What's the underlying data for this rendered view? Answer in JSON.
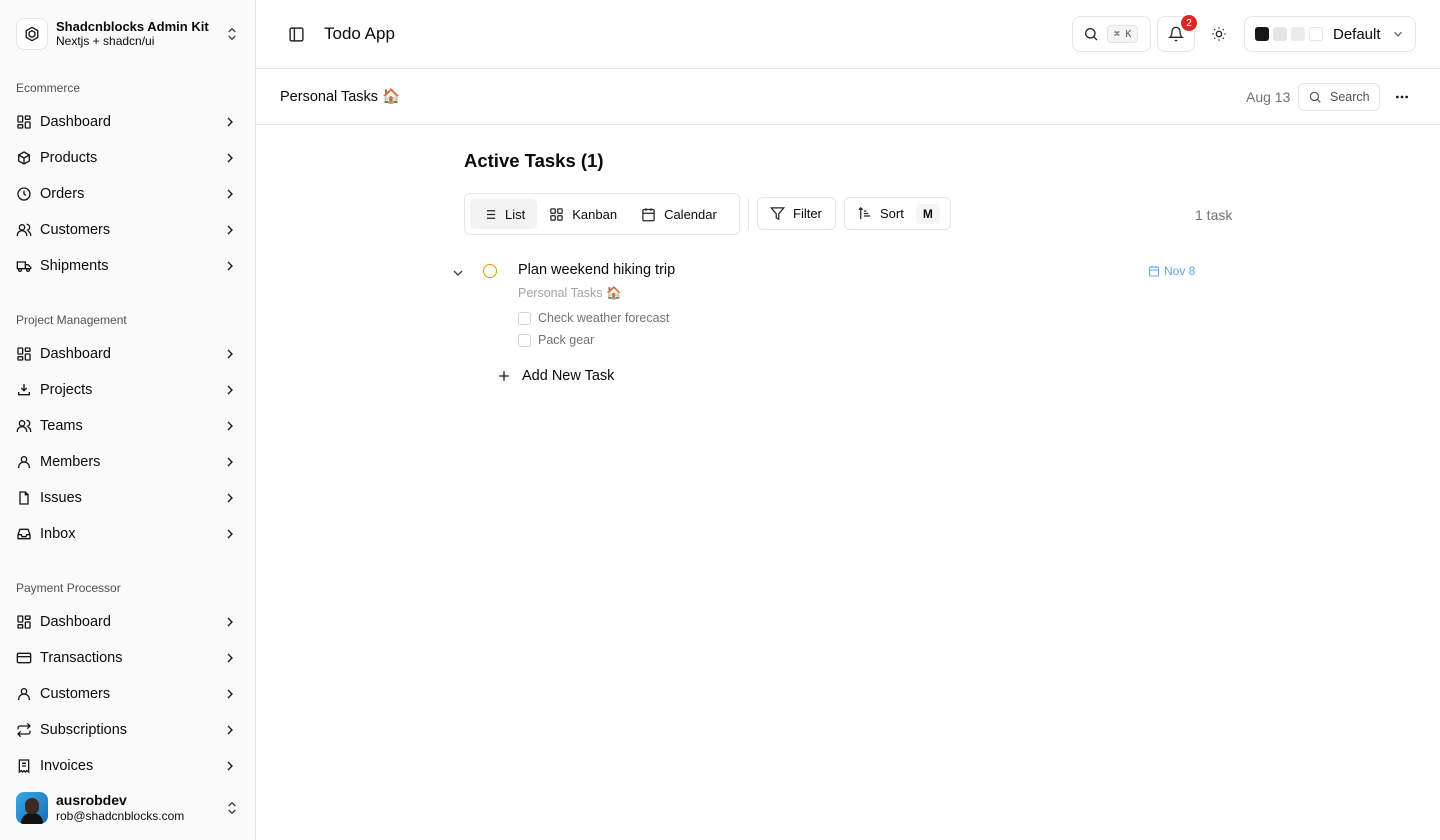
{
  "team": {
    "name": "Shadcnblocks Admin Kit",
    "subtitle": "Nextjs + shadcn/ui"
  },
  "groups": [
    {
      "label": "Ecommerce",
      "items": [
        {
          "label": "Dashboard",
          "icon": "layout-grid-icon"
        },
        {
          "label": "Products",
          "icon": "package-icon"
        },
        {
          "label": "Orders",
          "icon": "clipboard-icon"
        },
        {
          "label": "Customers",
          "icon": "users-icon"
        },
        {
          "label": "Shipments",
          "icon": "truck-icon"
        }
      ]
    },
    {
      "label": "Project Management",
      "items": [
        {
          "label": "Dashboard",
          "icon": "layout-grid-icon"
        },
        {
          "label": "Projects",
          "icon": "folder-icon"
        },
        {
          "label": "Teams",
          "icon": "users-icon"
        },
        {
          "label": "Members",
          "icon": "user-icon"
        },
        {
          "label": "Issues",
          "icon": "file-icon"
        },
        {
          "label": "Inbox",
          "icon": "inbox-icon"
        }
      ]
    },
    {
      "label": "Payment Processor",
      "items": [
        {
          "label": "Dashboard",
          "icon": "layout-grid-icon"
        },
        {
          "label": "Transactions",
          "icon": "credit-card-icon"
        },
        {
          "label": "Customers",
          "icon": "user-icon"
        },
        {
          "label": "Subscriptions",
          "icon": "repeat-icon"
        },
        {
          "label": "Invoices",
          "icon": "receipt-icon"
        }
      ]
    }
  ],
  "user": {
    "name": "ausrobdev",
    "email": "rob@shadcnblocks.com"
  },
  "header": {
    "title": "Todo App",
    "search_shortcut": "⌘ K",
    "notification_count": "2",
    "theme_label": "Default",
    "theme_swatches": [
      "#171717",
      "#e5e5e5",
      "#ebebeb",
      "#ffffff"
    ]
  },
  "subheader": {
    "breadcrumb": "Personal Tasks 🏠",
    "date": "Aug 13",
    "search_label": "Search"
  },
  "content": {
    "section_title": "Active Tasks (1)",
    "tabs": [
      "List",
      "Kanban",
      "Calendar"
    ],
    "active_tab": "List",
    "filter_label": "Filter",
    "sort_label": "Sort",
    "sort_shortcut": "M",
    "task_count": "1 task",
    "tasks": [
      {
        "title": "Plan weekend hiking trip",
        "project": "Personal Tasks 🏠",
        "due": "Nov 8",
        "status_color": "#d4a106",
        "subtasks": [
          {
            "label": "Check weather forecast",
            "done": false
          },
          {
            "label": "Pack gear",
            "done": false
          }
        ]
      }
    ],
    "add_task_label": "Add New Task"
  }
}
